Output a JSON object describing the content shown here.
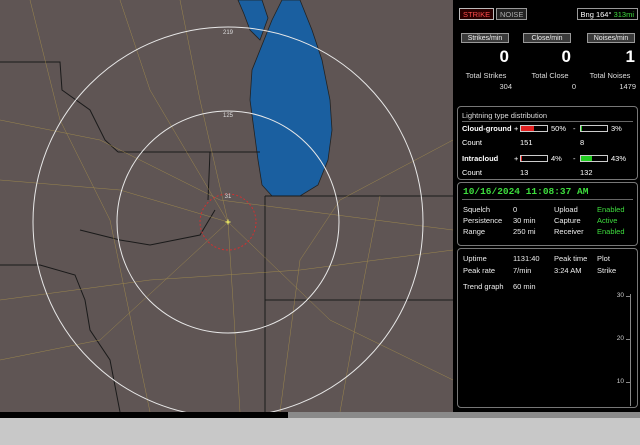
{
  "map": {
    "ring_labels": [
      "219",
      "125",
      "31"
    ],
    "water_color": "#1a5fa0",
    "land_color": "#5f5554"
  },
  "header": {
    "strike_tab": "STRIKE",
    "noise_tab": "NOISE",
    "bearing_label": "Bng 164°",
    "range_value": "313mi"
  },
  "counters": {
    "strikes_min": {
      "label": "Strikes/min",
      "value": "0"
    },
    "close_min": {
      "label": "Close/min",
      "value": "0"
    },
    "noises_min": {
      "label": "Noises/min",
      "value": "1"
    },
    "total_strikes": {
      "label": "Total Strikes",
      "value": "304"
    },
    "total_close": {
      "label": "Total Close",
      "value": "0"
    },
    "total_noises": {
      "label": "Total Noises",
      "value": "1479"
    }
  },
  "distribution": {
    "title": "Lightning type distribution",
    "cloud_ground": {
      "label": "Cloud-ground",
      "plus_sign": "+",
      "plus_pct": "50%",
      "plus_fraction": 0.5,
      "minus_sign": "-",
      "minus_pct": "3%",
      "minus_fraction": 0.03,
      "count_label": "Count",
      "plus_count": "151",
      "minus_count": "8"
    },
    "intracloud": {
      "label": "Intracloud",
      "plus_sign": "+",
      "plus_pct": "4%",
      "plus_fraction": 0.04,
      "minus_sign": "-",
      "minus_pct": "43%",
      "minus_fraction": 0.43,
      "count_label": "Count",
      "plus_count": "13",
      "minus_count": "132"
    },
    "colors": {
      "positive": "#e02020",
      "negative": "#22cc22"
    }
  },
  "status": {
    "datetime": "10/16/2024 11:08:37 AM",
    "squelch": {
      "label": "Squelch",
      "value": "0"
    },
    "persistence": {
      "label": "Persistence",
      "value": "30 min"
    },
    "range": {
      "label": "Range",
      "value": "250 mi"
    },
    "upload": {
      "label": "Upload",
      "value": "Enabled"
    },
    "capture": {
      "label": "Capture",
      "value": "Active"
    },
    "receiver": {
      "label": "Receiver",
      "value": "Enabled"
    }
  },
  "stats": {
    "uptime": {
      "label": "Uptime",
      "value": "1131:40"
    },
    "peak_rate": {
      "label": "Peak rate",
      "value": "7/min"
    },
    "peak_time": {
      "label": "Peak time",
      "value": "3:24 AM"
    },
    "plot": {
      "label": "Plot",
      "value": "Strike"
    },
    "trend": {
      "label": "Trend graph",
      "value": "60 min"
    },
    "axis_labels": [
      "30",
      "20",
      "10"
    ]
  }
}
